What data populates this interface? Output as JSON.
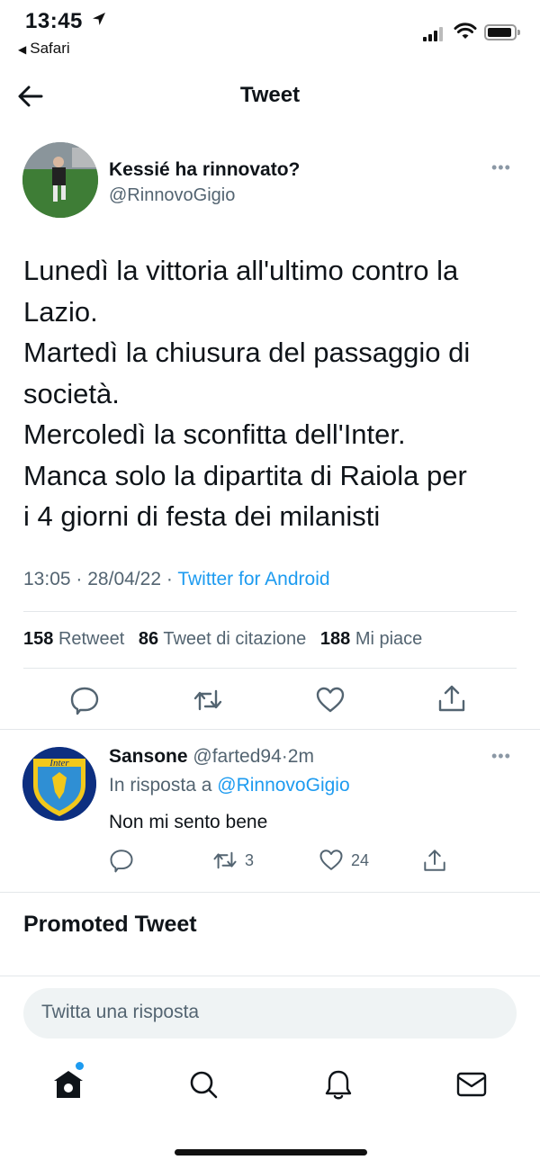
{
  "status_bar": {
    "time": "13:45",
    "back_app": "Safari"
  },
  "nav": {
    "title": "Tweet",
    "back_icon": "arrow-left-icon"
  },
  "tweet": {
    "author_name": "Kessié ha rinnovato?",
    "author_handle": "@RinnovoGigio",
    "text_lines": [
      "Lunedì la vittoria all'ultimo contro la",
      "Lazio.",
      "Martedì la chiusura del passaggio di",
      "società.",
      "Mercoledì la sconfitta dell'Inter.",
      "Manca solo la dipartita di Raiola per",
      "i 4 giorni di festa dei milanisti"
    ],
    "meta": {
      "time": "13:05",
      "date": "28/04/22",
      "separator": "·",
      "source": "Twitter for Android"
    },
    "stats": {
      "retweets_count": "158",
      "retweets_label": "Retweet",
      "quotes_count": "86",
      "quotes_label": "Tweet di citazione",
      "likes_count": "188",
      "likes_label": "Mi piace"
    },
    "actions": [
      "reply-icon",
      "retweet-icon",
      "like-icon",
      "share-icon"
    ]
  },
  "reply": {
    "name": "Sansone",
    "handle": "@farted94",
    "separator": "·",
    "age": "2m",
    "in_reply_prefix": "In risposta a",
    "in_reply_mention": "@RinnovoGigio",
    "text": "Non mi sento bene",
    "retweets": "3",
    "likes": "24",
    "avatar_text": "Inter"
  },
  "promoted": {
    "title": "Promoted Tweet"
  },
  "composer": {
    "placeholder": "Twitta una risposta"
  },
  "tab_bar": [
    "home-icon",
    "search-icon",
    "notifications-icon",
    "messages-icon"
  ],
  "colors": {
    "accent": "#1d9bf0",
    "text_primary": "#0f1419",
    "text_secondary": "#536471",
    "divider": "#e3e7ea"
  }
}
